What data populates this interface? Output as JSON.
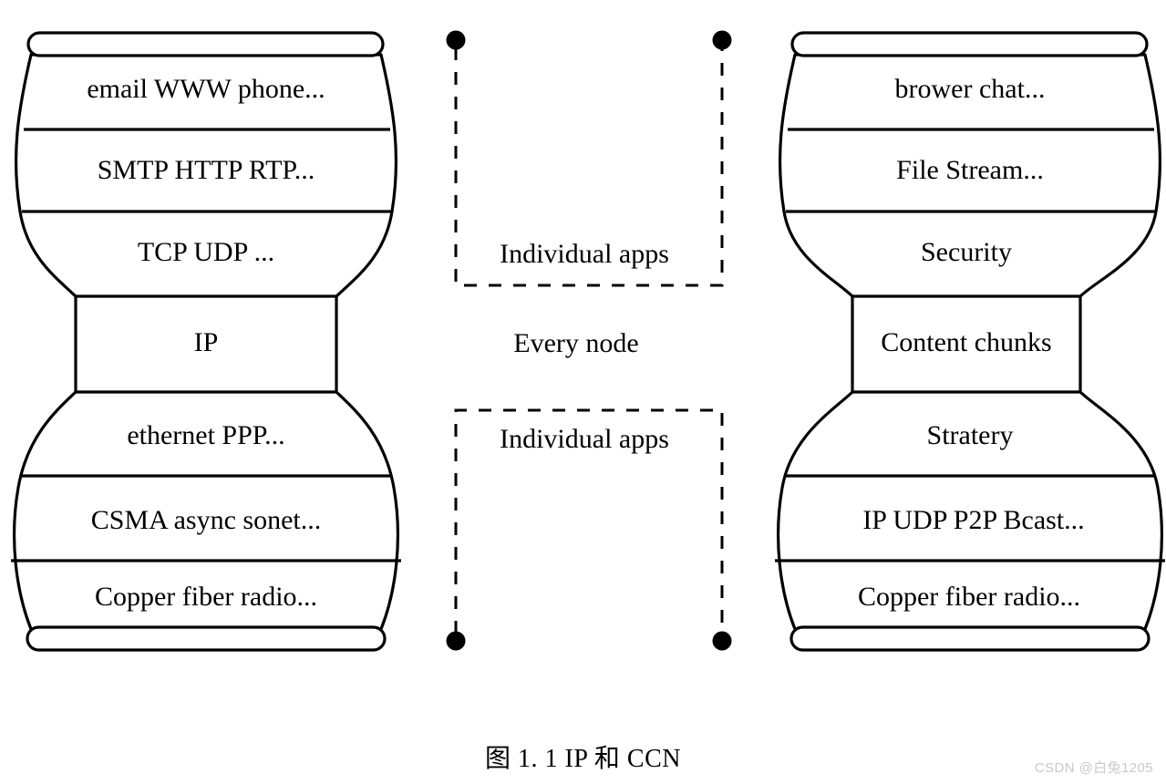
{
  "figure": {
    "caption": "图 1. 1 IP 和 CCN",
    "watermark": "CSDN @白兔1205"
  },
  "left_stack": {
    "name": "IP hourglass",
    "layers": [
      {
        "id": "ip-l1",
        "label": "email WWW phone..."
      },
      {
        "id": "ip-l2",
        "label": "SMTP HTTP RTP..."
      },
      {
        "id": "ip-l3",
        "label": "TCP UDP ..."
      },
      {
        "id": "ip-waist",
        "label": "IP"
      },
      {
        "id": "ip-l5",
        "label": "ethernet PPP..."
      },
      {
        "id": "ip-l6",
        "label": "CSMA async sonet..."
      },
      {
        "id": "ip-l7",
        "label": "Copper fiber radio..."
      }
    ]
  },
  "right_stack": {
    "name": "CCN hourglass",
    "layers": [
      {
        "id": "ccn-l1",
        "label": "brower chat..."
      },
      {
        "id": "ccn-l2",
        "label": "File Stream..."
      },
      {
        "id": "ccn-l3",
        "label": "Security"
      },
      {
        "id": "ccn-waist",
        "label": "Content chunks"
      },
      {
        "id": "ccn-l5",
        "label": "Stratery"
      },
      {
        "id": "ccn-l6",
        "label": "IP UDP P2P Bcast..."
      },
      {
        "id": "ccn-l7",
        "label": "Copper fiber radio..."
      }
    ]
  },
  "middle_annotations": {
    "top_bracket_label": "Individual apps",
    "center_label": "Every node",
    "bottom_bracket_label": "Individual apps"
  },
  "colors": {
    "stroke": "#000000",
    "background": "#ffffff",
    "watermark": "#c9c9c9"
  }
}
